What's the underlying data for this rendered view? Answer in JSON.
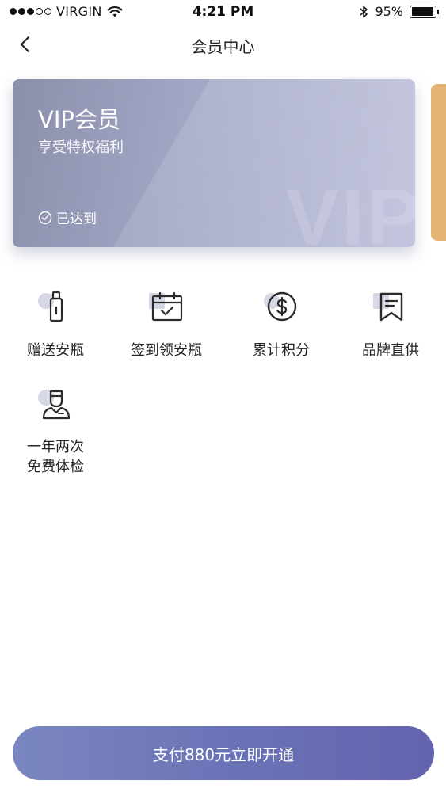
{
  "status_bar": {
    "carrier": "VIRGIN",
    "time": "4:21 PM",
    "battery": "95%",
    "battery_level": 0.95
  },
  "nav": {
    "title": "会员中心",
    "back_icon": "chevron-left-icon"
  },
  "vip_card": {
    "title": "VIP会员",
    "subtitle": "享受特权福利",
    "status": "已达到",
    "watermark": "VIP",
    "status_icon": "check-circle-icon"
  },
  "next_card_color": "#e3b574",
  "benefits": [
    {
      "label": "赠送安瓶",
      "icon": "ampoule-bottle-icon"
    },
    {
      "label": "签到领安瓶",
      "icon": "calendar-check-icon"
    },
    {
      "label": "累计积分",
      "icon": "dollar-coin-icon"
    },
    {
      "label": "品牌直供",
      "icon": "bookmark-flag-icon"
    },
    {
      "label": "一年两次\n免费体检",
      "icon": "doctor-icon"
    }
  ],
  "pay_button": {
    "label": "支付880元立即开通"
  },
  "colors": {
    "card_start": "#8a8fac",
    "card_end": "#c1c3de",
    "button_start": "#7a86c0",
    "button_end": "#6463ae",
    "icon_stroke": "#2b2b2b",
    "icon_accent": "#d6d8e6"
  }
}
